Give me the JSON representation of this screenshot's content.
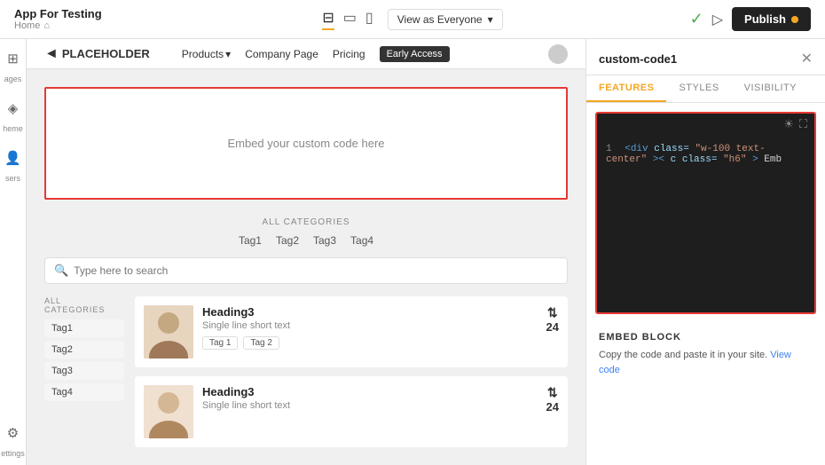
{
  "topbar": {
    "app_title": "App For Testing",
    "breadcrumb": "Home",
    "home_icon": "⌂",
    "view_as_label": "View as Everyone",
    "publish_label": "Publish"
  },
  "devices": [
    {
      "name": "desktop",
      "icon": "🖥",
      "active": true
    },
    {
      "name": "tablet",
      "icon": "⊡",
      "active": false
    },
    {
      "name": "mobile",
      "icon": "📱",
      "active": false
    }
  ],
  "sidebar_icons": [
    {
      "name": "pages",
      "icon": "⊞",
      "label": "ages"
    },
    {
      "name": "theme",
      "icon": "◈",
      "label": "heme"
    },
    {
      "name": "users",
      "icon": "👤",
      "label": "sers"
    },
    {
      "name": "settings",
      "icon": "⚙",
      "label": "ettings"
    }
  ],
  "preview": {
    "logo_arrow": "◄",
    "logo_text": "PLACEHOLDER",
    "nav_items": [
      {
        "label": "Products",
        "has_dropdown": true
      },
      {
        "label": "Company Page",
        "has_dropdown": false
      },
      {
        "label": "Pricing",
        "has_dropdown": false
      },
      {
        "label": "Early Access",
        "active": true
      }
    ]
  },
  "embed_block": {
    "placeholder_text": "Embed your custom code here"
  },
  "content": {
    "all_categories_label": "ALL CATEGORIES",
    "tags": [
      "Tag1",
      "Tag2",
      "Tag3",
      "Tag4"
    ],
    "search_placeholder": "Type here to search",
    "sidebar_categories_label": "ALL CATEGORIES",
    "sidebar_tags": [
      "Tag1",
      "Tag2",
      "Tag3",
      "Tag4"
    ],
    "cards": [
      {
        "heading": "Heading3",
        "description": "Single line short text",
        "tags": [
          "Tag 1",
          "Tag 2"
        ],
        "count": "24"
      },
      {
        "heading": "Heading3",
        "description": "Single line short text",
        "tags": [],
        "count": "24"
      }
    ]
  },
  "right_panel": {
    "title": "custom-code1",
    "tabs": [
      {
        "label": "FEATURES",
        "active": true
      },
      {
        "label": "STYLES",
        "active": false
      },
      {
        "label": "VISIBILITY",
        "active": false
      }
    ],
    "code_line": "1",
    "code_content": "<div class=\"w-100 text-center\"><c class=\"h6\">Emb",
    "embed_block_title": "EMBED BLOCK",
    "embed_block_desc": "Copy the code and paste it in your site.",
    "view_code_link": "View code"
  }
}
